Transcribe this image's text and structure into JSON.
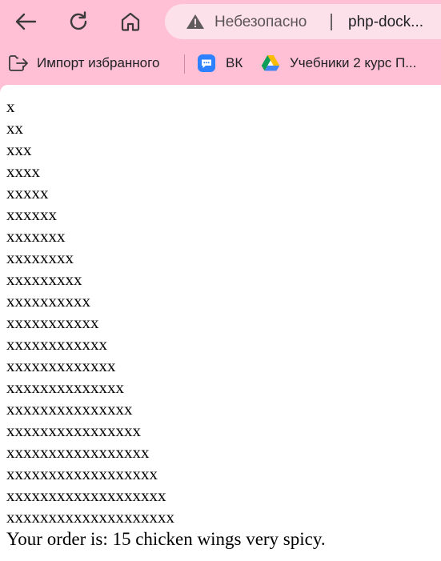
{
  "toolbar": {
    "security_label": "Небезопасно",
    "url": "php-dock..."
  },
  "bookmarks": {
    "items": [
      {
        "label": "Импорт избранного",
        "icon": "import-bookmarks-icon"
      },
      {
        "label": "ВК",
        "icon": "vk-chat-icon"
      },
      {
        "label": "Учебники 2 курс П...",
        "icon": "google-drive-icon"
      }
    ]
  },
  "page": {
    "lines": [
      "x",
      "xx",
      "xxx",
      "xxxx",
      "xxxxx",
      "xxxxxx",
      "xxxxxxx",
      "xxxxxxxx",
      "xxxxxxxxx",
      "xxxxxxxxxx",
      "xxxxxxxxxxx",
      "xxxxxxxxxxxx",
      "xxxxxxxxxxxxx",
      "xxxxxxxxxxxxxx",
      "xxxxxxxxxxxxxxx",
      "xxxxxxxxxxxxxxxx",
      "xxxxxxxxxxxxxxxxx",
      "xxxxxxxxxxxxxxxxxx",
      "xxxxxxxxxxxxxxxxxxx",
      "xxxxxxxxxxxxxxxxxxxx"
    ],
    "order_text": "Your order is: 15 chicken wings very spicy."
  },
  "colors": {
    "chrome_background": "#ffbfd4",
    "address_bar": "#fde1ea",
    "page_background": "#ffffff"
  }
}
